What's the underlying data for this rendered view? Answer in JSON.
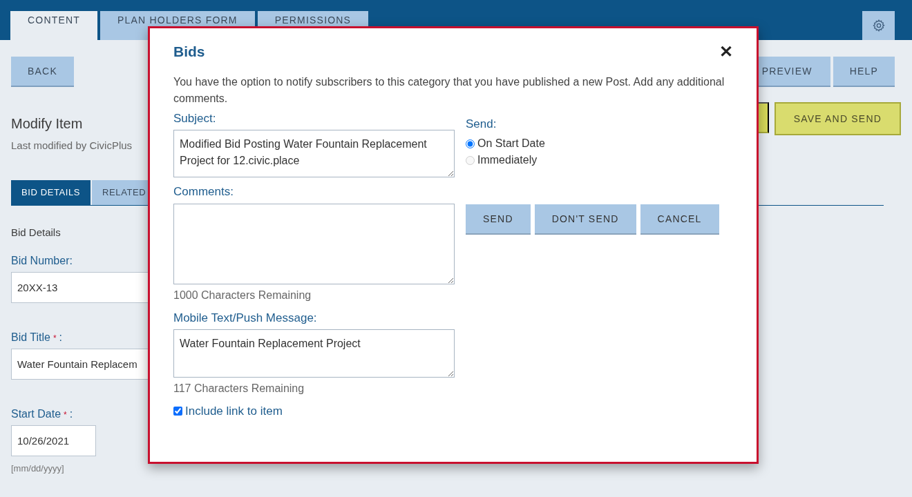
{
  "top_tabs": [
    {
      "label": "CONTENT",
      "selected": true
    },
    {
      "label": "PLAN HOLDERS FORM",
      "selected": false
    },
    {
      "label": "PERMISSIONS",
      "selected": false
    }
  ],
  "toolbar": {
    "back": "BACK",
    "preview": "PREVIEW",
    "help": "HELP",
    "save_and_send": "SAVE AND SEND"
  },
  "page": {
    "heading": "Modify Item",
    "last_modified": "Last modified by CivicPlus",
    "section_tabs": [
      {
        "label": "BID DETAILS",
        "selected": true
      },
      {
        "label": "RELATED",
        "selected": false
      }
    ],
    "section_title": "Bid Details",
    "fields": [
      {
        "label": "Bid Number:",
        "value": "20XX-13"
      },
      {
        "label": "Bid Title",
        "required_mark": "*",
        "colon": ":",
        "value": "Water Fountain Replacem"
      },
      {
        "label": "Start Date",
        "required_mark": "*",
        "colon": ":",
        "value": "10/26/2021",
        "hint": "[mm/dd/yyyy]"
      }
    ]
  },
  "dialog": {
    "title": "Bids",
    "close": "✕",
    "intro": "You have the option to notify subscribers to this category that you have published a new Post. Add any additional comments.",
    "subject": {
      "label": "Subject:",
      "value": "Modified Bid Posting Water Fountain Replacement Project for 12.civic.place"
    },
    "comments": {
      "label": "Comments:",
      "remaining": "1000 Characters Remaining"
    },
    "mobile": {
      "label": "Mobile Text/Push Message:",
      "value": "Water Fountain Replacement Project",
      "remaining": "117 Characters Remaining"
    },
    "include_link": {
      "label": "Include link to item",
      "checked": true
    },
    "send": {
      "label": "Send:",
      "options": [
        {
          "label": "On Start Date",
          "selected": true,
          "disabled": false
        },
        {
          "label": "Immediately",
          "selected": false,
          "disabled": true
        }
      ]
    },
    "buttons": [
      "SEND",
      "DON'T SEND",
      "CANCEL"
    ]
  }
}
